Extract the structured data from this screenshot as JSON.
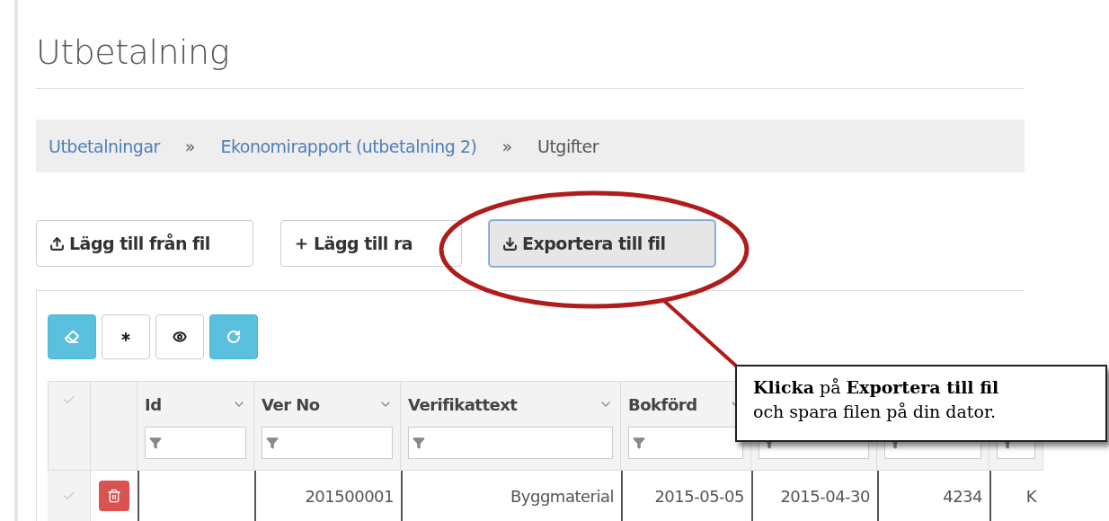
{
  "title": "Utbetalning",
  "breadcrumb": [
    {
      "label": "Utbetalningar",
      "link": true
    },
    {
      "label": "Ekonomirapport (utbetalning 2)",
      "link": true
    },
    {
      "label": "Utgifter",
      "link": false
    }
  ],
  "separator": "»",
  "buttons": [
    {
      "label": "Lägg till från fil",
      "focused": false
    },
    {
      "label": "Lägg till ra",
      "focused": false
    },
    {
      "label": "Exportera till fil",
      "focused": true
    }
  ],
  "toolbar": [
    {
      "kind": "primary"
    },
    {
      "kind": "default"
    },
    {
      "kind": "default"
    },
    {
      "kind": "primary"
    }
  ],
  "table": {
    "columns": [
      "Id",
      "Ver No",
      "Verifikattext",
      "Bokförd"
    ],
    "rows": [
      {
        "cells": [
          "",
          "201500001",
          "Byggmaterial",
          "2015-05-05",
          "2015-04-30",
          "4234",
          "K"
        ]
      }
    ]
  },
  "callout": {
    "text": "**Klicka** på **Exportera till fil**\noch spara filen på din dator."
  }
}
